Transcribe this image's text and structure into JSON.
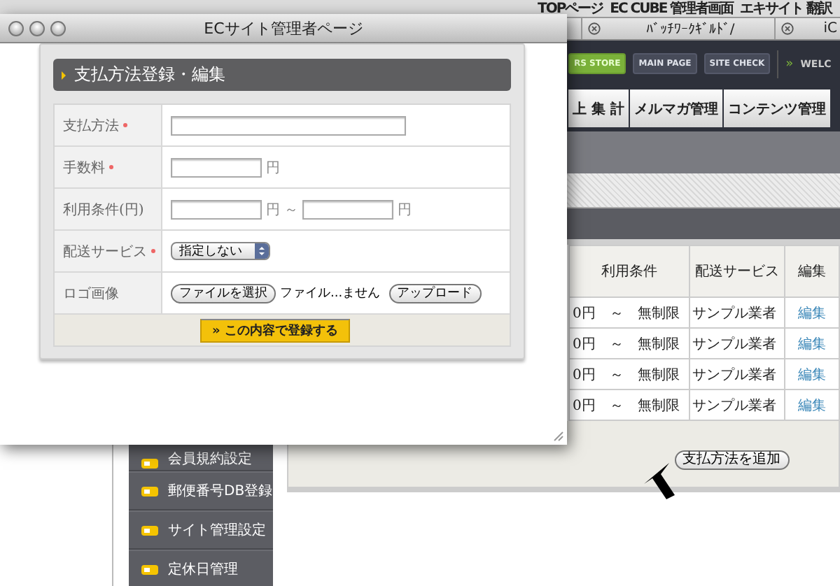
{
  "bookmarks": [
    "TOPページ",
    "EC CUBE 管理者画面",
    "エキサイト 翻訳"
  ],
  "browser_tabs": [
    {
      "label": "ﾊﾞｯﾁﾜｰｸｷﾞﾙﾄﾞ/"
    },
    {
      "label": "iC"
    }
  ],
  "header_buttons": [
    {
      "label": "RS STORE",
      "kind": "store"
    },
    {
      "label": "MAIN PAGE",
      "kind": "plain"
    },
    {
      "label": "SITE CHECK",
      "kind": "plain"
    }
  ],
  "welcome": {
    "mark": "»",
    "text": "WELC"
  },
  "nav_tabs": [
    "上 集 計",
    "メルマガ管理",
    "コンテンツ管理"
  ],
  "table": {
    "columns": [
      "利用条件",
      "配送サービス",
      "編集"
    ],
    "rows": [
      [
        "0円　～　無制限",
        "サンプル業者",
        "編集"
      ],
      [
        "0円　～　無制限",
        "サンプル業者",
        "編集"
      ],
      [
        "0円　～　無制限",
        "サンプル業者",
        "編集"
      ],
      [
        "0円　～　無制限",
        "サンプル業者",
        "編集"
      ]
    ]
  },
  "add_button": "支払方法を追加",
  "sidebar": {
    "items": [
      "会員規約設定",
      "郵便番号DB登録",
      "サイト管理設定",
      "定休日管理"
    ]
  },
  "popup": {
    "title": "ECサイト管理者ページ",
    "heading": "支払方法登録・編集",
    "fields": [
      {
        "kind": "text",
        "label": "支払方法",
        "required": true
      },
      {
        "kind": "number",
        "label": "手数料",
        "required": true,
        "unit": "円"
      },
      {
        "kind": "range",
        "label": "利用条件(円)",
        "required": false,
        "unit": "円",
        "separator": "～",
        "unit_to": "円"
      },
      {
        "kind": "select",
        "label": "配送サービス",
        "required": true,
        "value": "指定しない"
      },
      {
        "kind": "file",
        "label": "ロゴ画像",
        "required": false,
        "choose": "ファイルを選択",
        "status": "ファイル...ません",
        "upload": "アップロード"
      }
    ],
    "submit": "» この内容で登録する"
  }
}
